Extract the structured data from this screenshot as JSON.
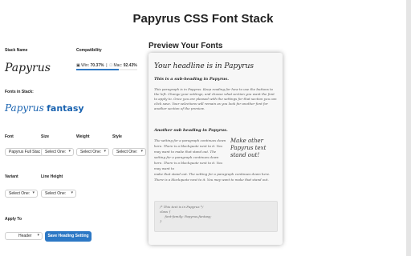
{
  "page": {
    "title": "Papyrus CSS Font Stack"
  },
  "stack": {
    "name_label": "Stack Name",
    "name_value": "Papyrus",
    "compat_label": "Compatibility",
    "compat_win_prefix": "Win:",
    "compat_win": "70.37%",
    "compat_mac_prefix": "Mac:",
    "compat_mac": "92.43%",
    "compat_win_fraction": 0.7037,
    "fonts_label": "Fonts in Stack:",
    "fonts_value_1": "Papyrus",
    "fonts_value_2": "fantasy"
  },
  "controls": {
    "font_label": "Font",
    "size_label": "Size",
    "weight_label": "Weight",
    "style_label": "Style",
    "variant_label": "Variant",
    "line_height_label": "Line Height",
    "apply_label": "Apply To",
    "font_select": "Papyrus Full Stac",
    "size_select": "Select One:",
    "weight_select": "Select One:",
    "style_select": "Select One:",
    "variant_select": "Select One:",
    "line_height_select": "Select One:",
    "apply_select": "Header",
    "save_button": "Save Heading Setting"
  },
  "preview": {
    "title": "Preview Your Fonts",
    "headline": "Your headline is in Papyrus",
    "subheading_1": "This is a sub-heading in Papyrus.",
    "paragraph_1": "This paragraph is in Papyrus. Keep reading for how to use the buttons to the left. Change your settings, and choose what section you want the font to apply to. Once you are pleased with the settings for that section you can click save. Your selections will remain as you look for another font for another section of the preview.",
    "subheading_2": "Another sub heading in Papyrus.",
    "paragraph_2": "The setting for a paragraph continues down here. There is a blockquote next to it. You may want to make that stand out. The setting for a paragraph continues down here. There is a blockquote next to it. You may want to",
    "paragraph_3": "make that stand out. The setting for a paragraph continues down here. There is a blockquote next to it. You may want to make that stand out.",
    "blockquote": "Make other Papyrus text stand out!",
    "code_lines": [
      "/* This text is in Papyrus */",
      "class {",
      "     font-family: Papyrus,fantasy;",
      "}"
    ]
  }
}
